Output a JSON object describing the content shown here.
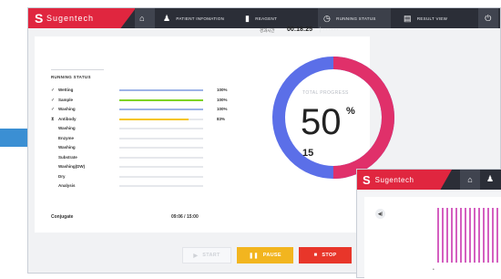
{
  "app": {
    "logo_glyph": "S",
    "brand_name": "Sugentech",
    "brand_color": "#e0263f",
    "topbar_color": "#2b2e37"
  },
  "nav": {
    "home_icon": "home-icon",
    "patient_info": "PATIENT INFOMATION",
    "reagent": "REAGENT",
    "running_status": "RUNNING STATUS",
    "result_view": "RESULT VIEW",
    "power_icon": "power-icon"
  },
  "running_status": {
    "title": "RUNNING STATUS",
    "steps": [
      {
        "mark": "✓",
        "label": "Wetting",
        "progress": 100,
        "pct": "100%",
        "color": "#9db3e8"
      },
      {
        "mark": "✓",
        "label": "Sample",
        "progress": 100,
        "pct": "100%",
        "color": "#7ed321"
      },
      {
        "mark": "✓",
        "label": "Washing",
        "progress": 100,
        "pct": "100%",
        "color": "#9db3e8"
      },
      {
        "mark": "⧗",
        "label": "Antibody",
        "progress": 83,
        "pct": "83%",
        "color": "#f5c518"
      },
      {
        "mark": "",
        "label": "Washing",
        "progress": 0,
        "pct": "",
        "color": "#e6e8ec"
      },
      {
        "mark": "",
        "label": "Enzyme",
        "progress": 0,
        "pct": "",
        "color": "#e6e8ec"
      },
      {
        "mark": "",
        "label": "Washing",
        "progress": 0,
        "pct": "",
        "color": "#e6e8ec"
      },
      {
        "mark": "",
        "label": "Substrate",
        "progress": 0,
        "pct": "",
        "color": "#e6e8ec"
      },
      {
        "mark": "",
        "label": "Washing(DW)",
        "progress": 0,
        "pct": "",
        "color": "#e6e8ec"
      },
      {
        "mark": "",
        "label": "Dry",
        "progress": 0,
        "pct": "",
        "color": "#e6e8ec"
      },
      {
        "mark": "",
        "label": "Analysis",
        "progress": 0,
        "pct": "",
        "color": "#e6e8ec"
      }
    ],
    "conjugate_label": "Conjugate",
    "conjugate_time": "09:06 / 15:00"
  },
  "total": {
    "elapsed_label": "경과시간",
    "elapsed_value": "00:18:25",
    "progress_label": "TOTAL PROGRESS",
    "percent": 50,
    "percent_text": "50",
    "percent_sign": "%",
    "remaining_value": "15",
    "ring_done_color": "#e0306a",
    "ring_todo_color": "#5b6fe8"
  },
  "buttons": {
    "start": "START",
    "pause": "PAUSE",
    "stop": "STOP"
  },
  "overlay": {
    "logo_glyph": "S",
    "brand_name": "Sugentech",
    "speaker_icon": "speaker-icon",
    "stripe_color": "#d45fc0"
  }
}
